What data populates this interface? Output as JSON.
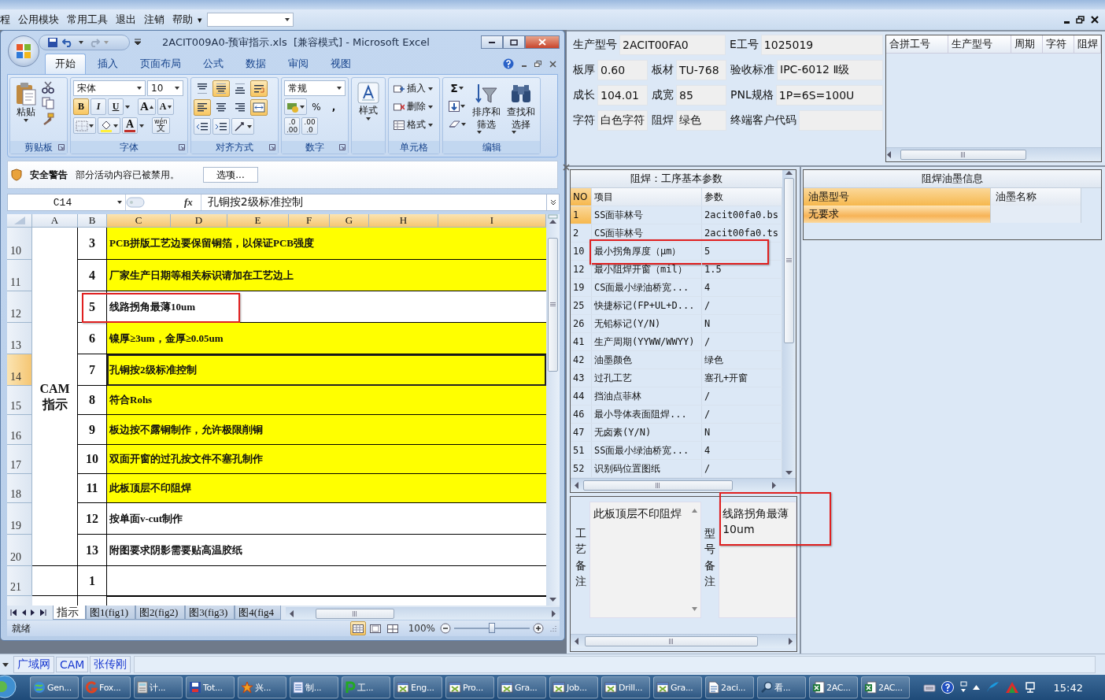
{
  "menu": {
    "items": [
      "程",
      "公用模块",
      "常用工具",
      "退出",
      "注销",
      "帮助"
    ],
    "more": "▾"
  },
  "excel": {
    "title": "2ACIT009A0-预审指示.xls  [兼容模式] - Microsoft Excel",
    "tabs": [
      {
        "label": "开始",
        "selected": true
      },
      {
        "label": "插入",
        "selected": false
      },
      {
        "label": "页面布局",
        "selected": false
      },
      {
        "label": "公式",
        "selected": false
      },
      {
        "label": "数据",
        "selected": false
      },
      {
        "label": "审阅",
        "selected": false
      },
      {
        "label": "视图",
        "selected": false
      }
    ],
    "clipboard": {
      "paste": "粘贴",
      "group": "剪贴板"
    },
    "font": {
      "name": "宋体",
      "size": "10",
      "styles": [
        {
          "label": "B",
          "on": true
        },
        {
          "label": "I",
          "on": false
        },
        {
          "label": "U",
          "on": false
        }
      ],
      "grow": "A",
      "shrink": "A",
      "color_letter": "A",
      "phonetic": {
        "pinyin": "wén",
        "char": "文"
      },
      "group": "字体"
    },
    "alignment": {
      "buttons": [
        {
          "kind": "top",
          "on": false
        },
        {
          "kind": "middle",
          "on": true
        },
        {
          "kind": "bottom",
          "on": false
        },
        {
          "kind": "wrap",
          "on": true
        },
        {
          "kind": "left",
          "on": true
        },
        {
          "kind": "center",
          "on": false
        },
        {
          "kind": "right",
          "on": false
        },
        {
          "kind": "merge",
          "on": true
        }
      ],
      "group": "对齐方式"
    },
    "number": {
      "format": "常规",
      "percent": "%",
      "comma": ",",
      "decimals": [
        {
          "top": ".0",
          "bottom": ".00"
        },
        {
          "top": ".00",
          "bottom": ".0"
        }
      ],
      "group": "数字"
    },
    "styles": {
      "label": "样式"
    },
    "cells": {
      "items": [
        "插入",
        "删除",
        "格式"
      ],
      "group": "单元格"
    },
    "editing": {
      "sum": "Σ",
      "sort": [
        "排序和",
        "筛选"
      ],
      "find": [
        "查找和",
        "选择"
      ],
      "group": "编辑"
    },
    "security": {
      "title": "安全警告",
      "message": "部分活动内容已被禁用。",
      "button": "选项..."
    },
    "formula": {
      "cell": "C14",
      "fx": "fx",
      "value": "孔铜按2级标准控制"
    },
    "columns": [
      {
        "label": "A",
        "selected": false
      },
      {
        "label": "B",
        "selected": false
      },
      {
        "label": "C",
        "selected": true
      },
      {
        "label": "D",
        "selected": true
      },
      {
        "label": "E",
        "selected": true
      },
      {
        "label": "F",
        "selected": true
      },
      {
        "label": "G",
        "selected": true
      },
      {
        "label": "H",
        "selected": true
      },
      {
        "label": "I",
        "selected": true
      }
    ],
    "sections": [
      {
        "label": [
          "CAM",
          "指示"
        ],
        "rows": [
          {
            "row": "10",
            "no": "3",
            "text": "PCB拼版工艺边要保留铜箔，以保证PCB强度",
            "highlight": true,
            "selected": false,
            "annotated": false
          },
          {
            "row": "11",
            "no": "4",
            "text": "厂家生产日期等相关标识请加在工艺边上",
            "highlight": true,
            "selected": false,
            "annotated": false
          },
          {
            "row": "12",
            "no": "5",
            "text": "线路拐角最薄10um",
            "highlight": false,
            "selected": false,
            "annotated": true
          },
          {
            "row": "13",
            "no": "6",
            "text": "镍厚≥3um，金厚≥0.05um",
            "highlight": true,
            "selected": false,
            "annotated": false
          },
          {
            "row": "14",
            "no": "7",
            "text": "孔铜按2级标准控制",
            "highlight": true,
            "selected": true,
            "annotated": false
          },
          {
            "row": "15",
            "no": "8",
            "text": "符合Rohs",
            "highlight": true,
            "selected": false,
            "annotated": false
          },
          {
            "row": "16",
            "no": "9",
            "text": "板边按不露铜制作，允许极限削铜",
            "highlight": true,
            "selected": false,
            "annotated": false
          },
          {
            "row": "17",
            "no": "10",
            "text": "双面开窗的过孔按文件不塞孔制作",
            "highlight": true,
            "selected": false,
            "annotated": false
          },
          {
            "row": "18",
            "no": "11",
            "text": "此板顶层不印阻焊",
            "highlight": true,
            "selected": false,
            "annotated": false
          },
          {
            "row": "19",
            "no": "12",
            "text": "按单面v-cut制作",
            "highlight": false,
            "selected": false,
            "annotated": false
          },
          {
            "row": "20",
            "no": "13",
            "text": "附图要求阴影需要贴高温胶纸",
            "highlight": false,
            "selected": false,
            "annotated": false
          }
        ]
      },
      {
        "rows": [
          {
            "row": "21",
            "no": "1",
            "highlight": false,
            "selected": false,
            "annotated": false
          }
        ]
      }
    ],
    "sheets": [
      {
        "label": "指示",
        "selected": true
      },
      {
        "label": "图1(fig1)",
        "selected": false
      },
      {
        "label": "图2(fig2)",
        "selected": false
      },
      {
        "label": "图3(fig3)",
        "selected": false
      },
      {
        "label": "图4(fig4",
        "selected": false
      }
    ],
    "status": {
      "text": "就绪",
      "zoom": "100%",
      "level": 0.5
    }
  },
  "info": {
    "fields": [
      {
        "label": "生产型号",
        "value": "2ACIT00FA0"
      },
      {
        "label": "E工号",
        "value": "1025019"
      },
      {
        "label": "板厚",
        "value": "0.60"
      },
      {
        "label": "板材",
        "value": "TU-768"
      },
      {
        "label": "验收标准",
        "value": "IPC-6012 Ⅱ级"
      },
      {
        "label": "成长",
        "value": "104.01"
      },
      {
        "label": "成宽",
        "value": "85"
      },
      {
        "label": "PNL规格",
        "value": "1P=6S=100U"
      },
      {
        "label": "字符",
        "value": "白色字符"
      },
      {
        "label": "阻焊",
        "value": "绿色"
      },
      {
        "label": "终端客户代码"
      }
    ]
  },
  "merge_table": {
    "columns": [
      "合拼工号",
      "生产型号",
      "周期",
      "字符",
      "阻焊"
    ]
  },
  "params": {
    "title": "阻焊：工序基本参数",
    "columns": [
      "NO",
      "项目",
      "参数"
    ],
    "rows": [
      {
        "no": "1",
        "item": "SS面菲林号",
        "value": "2acit00fa0.bs",
        "selected": true,
        "annotated": false
      },
      {
        "no": "2",
        "item": "CS面菲林号",
        "value": "2acit00fa0.ts",
        "selected": false,
        "annotated": false
      },
      {
        "no": "10",
        "item": "最小拐角厚度（μm）",
        "value": "5",
        "selected": false,
        "annotated": true
      },
      {
        "no": "12",
        "item": "最小阻焊开窗（mil）",
        "value": "1.5",
        "selected": false,
        "annotated": false
      },
      {
        "no": "19",
        "item": "CS面最小绿油桥宽...",
        "value": "4",
        "selected": false,
        "annotated": false
      },
      {
        "no": "25",
        "item": "快捷标记(FP+UL+D...",
        "value": "/",
        "selected": false,
        "annotated": false
      },
      {
        "no": "26",
        "item": "无铅标记(Y/N)",
        "value": "N",
        "selected": false,
        "annotated": false
      },
      {
        "no": "41",
        "item": "生产周期(YYWW/WWYY)",
        "value": "/",
        "selected": false,
        "annotated": false
      },
      {
        "no": "42",
        "item": "油墨颜色",
        "value": "绿色",
        "selected": false,
        "annotated": false
      },
      {
        "no": "43",
        "item": "过孔工艺",
        "value": "塞孔+开窗",
        "selected": false,
        "annotated": false
      },
      {
        "no": "44",
        "item": "挡油点菲林",
        "value": "/",
        "selected": false,
        "annotated": false
      },
      {
        "no": "46",
        "item": "最小导体表面阻焊...",
        "value": "/",
        "selected": false,
        "annotated": false
      },
      {
        "no": "47",
        "item": "无卤素(Y/N)",
        "value": "N",
        "selected": false,
        "annotated": false
      },
      {
        "no": "51",
        "item": "SS面最小绿油桥宽...",
        "value": "4",
        "selected": false,
        "annotated": false
      },
      {
        "no": "52",
        "item": "识别码位置图纸",
        "value": "/",
        "selected": false,
        "annotated": false
      }
    ]
  },
  "ink": {
    "title": "阻焊油墨信息",
    "columns": [
      {
        "label": "油墨型号",
        "selected": true
      },
      {
        "label": "油墨名称",
        "selected": false
      }
    ],
    "rows": [
      {
        "model": "无要求",
        "selected": true
      }
    ]
  },
  "notes": [
    {
      "label": "工艺备注",
      "text": "此板顶层不印阻焊",
      "annotated": false
    },
    {
      "label": "型号备注",
      "text": "线路拐角最薄10um",
      "annotated": true
    }
  ],
  "bottom_tabs": [
    "广域网",
    "CAM",
    "张传刚"
  ],
  "taskbar": {
    "items": [
      {
        "label": "Gen...",
        "kind": "globe"
      },
      {
        "label": "Fox...",
        "kind": "swirl"
      },
      {
        "label": "计...",
        "kind": "calc"
      },
      {
        "label": "Tot...",
        "kind": "disk"
      },
      {
        "label": "兴...",
        "kind": "star"
      },
      {
        "label": "制...",
        "kind": "list"
      },
      {
        "label": "工...",
        "kind": "p"
      },
      {
        "label": "Eng...",
        "kind": "window"
      },
      {
        "label": "Pro...",
        "kind": "window"
      },
      {
        "label": "Gra...",
        "kind": "window"
      },
      {
        "label": "Job...",
        "kind": "window"
      },
      {
        "label": "Drill...",
        "kind": "window"
      },
      {
        "label": "Gra...",
        "kind": "window"
      },
      {
        "label": "2aci...",
        "kind": "doc"
      },
      {
        "label": "看...",
        "kind": "search"
      },
      {
        "label": "2AC...",
        "kind": "sheet"
      },
      {
        "label": "2AC...",
        "kind": "sheet"
      }
    ],
    "time": "15:42"
  }
}
